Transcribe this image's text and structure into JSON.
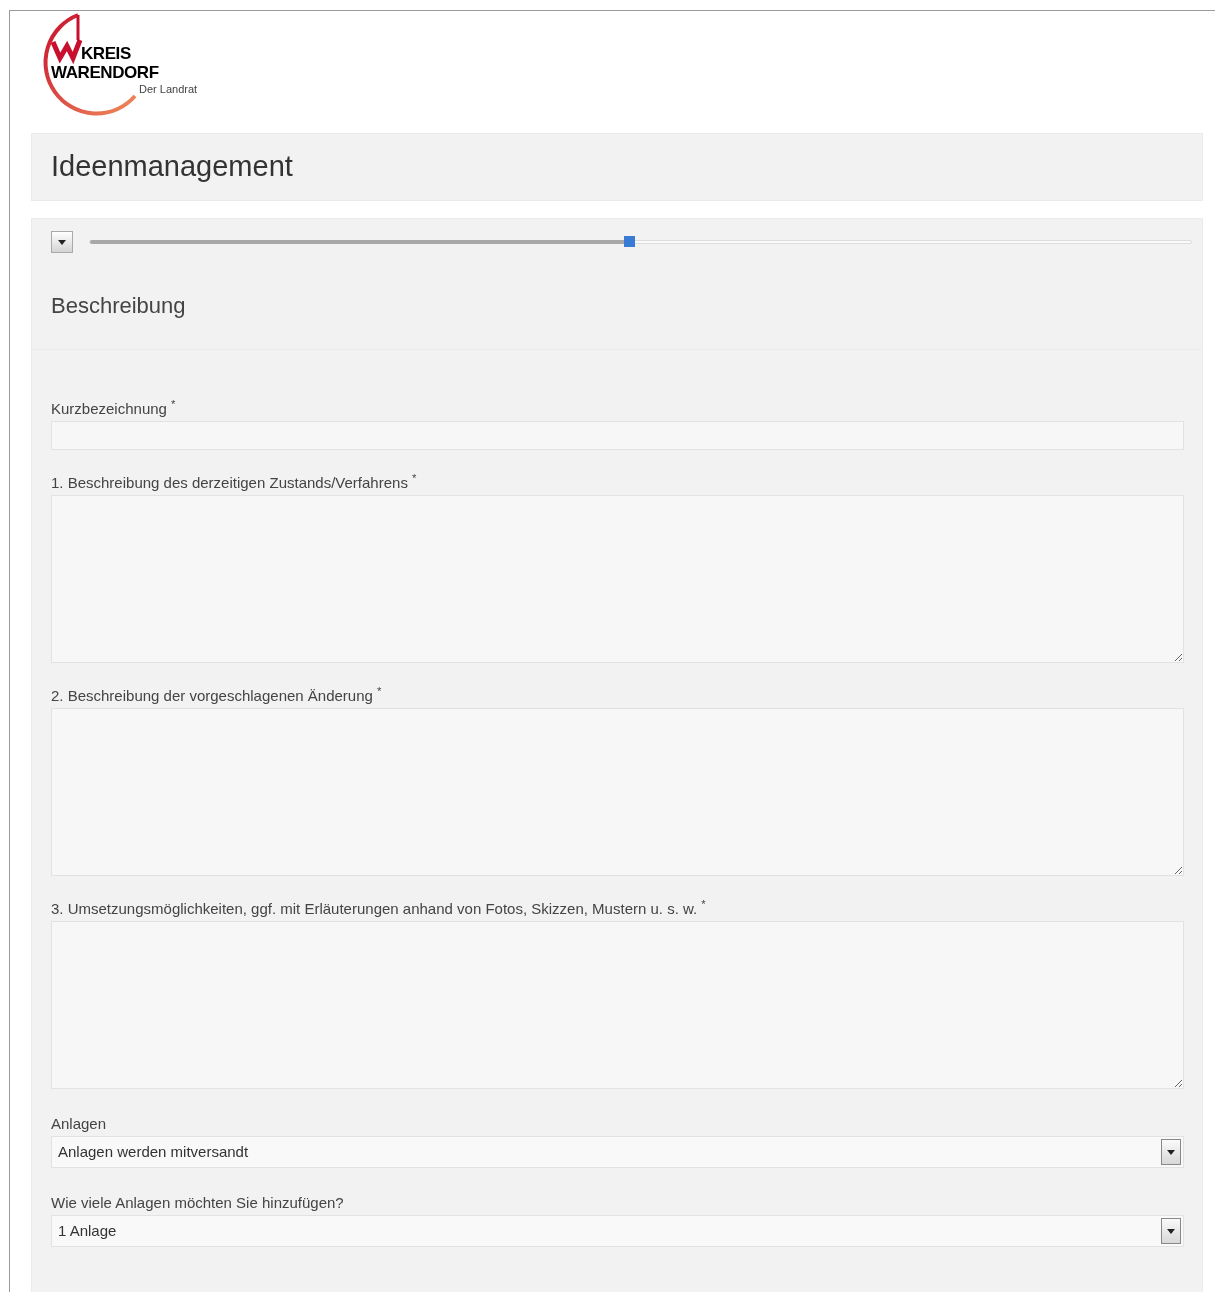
{
  "logo": {
    "line_1": "KREIS",
    "line_2": "WARENDORF",
    "line_3": "Der Landrat"
  },
  "header": {
    "title": "Ideenmanagement"
  },
  "form": {
    "collapsed": true,
    "progress": {
      "level": 0.49
    },
    "section_title": "Beschreibung",
    "fields": [
      {
        "kind": "text",
        "label": "Kurzbezeichnung $^{*}$"
      },
      {
        "kind": "textarea",
        "label": "1. Beschreibung des derzeitigen Zustands/Verfahrens $^{*}$"
      },
      {
        "kind": "textarea",
        "label": "2. Beschreibung der vorgeschlagenen Änderung $^{*}$"
      },
      {
        "kind": "textarea",
        "label": "3. Umsetzungsmöglichkeiten, ggf. mit Erläuterungen anhand von Fotos, Skizzen, Mustern u. s. w. $^{*}$"
      },
      {
        "kind": "select",
        "label": "Anlagen",
        "value": "Anlagen werden mitversandt"
      },
      {
        "kind": "select",
        "label": "Wie viele Anlagen möchten Sie hinzufügen?",
        "value": "1 Anlage"
      }
    ]
  }
}
